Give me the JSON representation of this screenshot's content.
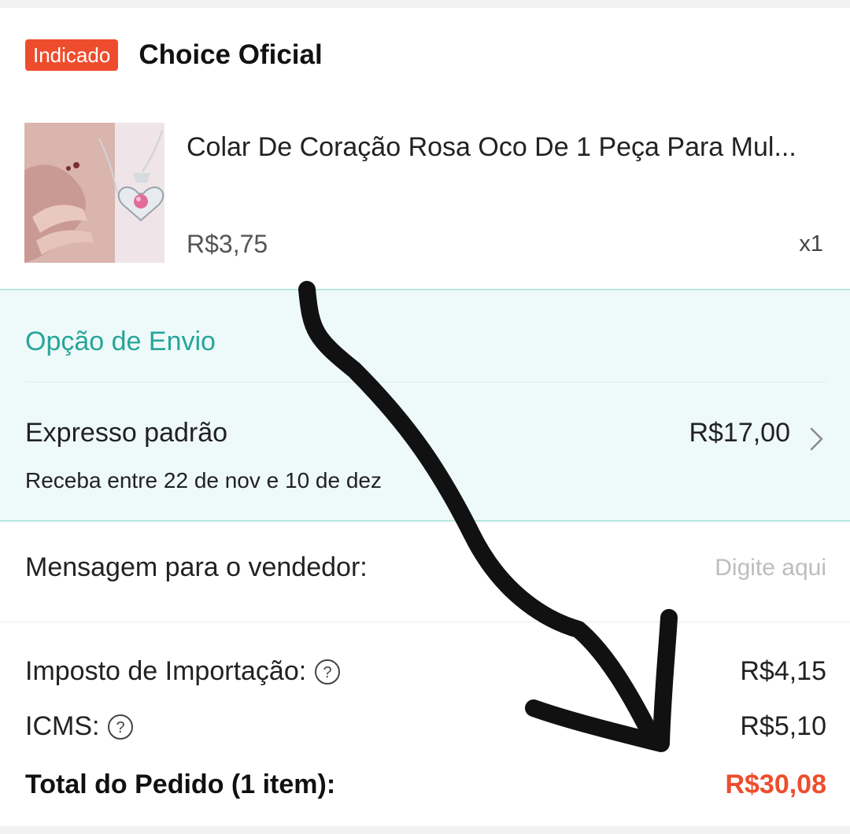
{
  "shop": {
    "badge": "Indicado",
    "name": "Choice Oficial"
  },
  "product": {
    "title": "Colar De Coração Rosa Oco De 1 Peça Para Mul...",
    "price": "R$3,75",
    "quantity": "x1"
  },
  "shipping": {
    "section_title": "Opção de Envio",
    "method": "Expresso padrão",
    "price": "R$17,00",
    "eta": "Receba entre 22 de nov e 10 de dez"
  },
  "message": {
    "label": "Mensagem para o vendedor:",
    "placeholder": "Digite aqui"
  },
  "fees": {
    "import_tax_label": "Imposto de Importação:",
    "import_tax_value": "R$4,15",
    "icms_label": "ICMS:",
    "icms_value": "R$5,10"
  },
  "total": {
    "label": "Total do Pedido (1 item):",
    "value": "R$30,08"
  },
  "colors": {
    "accent": "#ee4d2d",
    "shipping_teal": "#26a69a",
    "shipping_bg": "#eefaf9"
  },
  "icons": [
    "chevron-right-icon",
    "help-icon",
    "product-thumbnail",
    "annotation-arrow"
  ]
}
